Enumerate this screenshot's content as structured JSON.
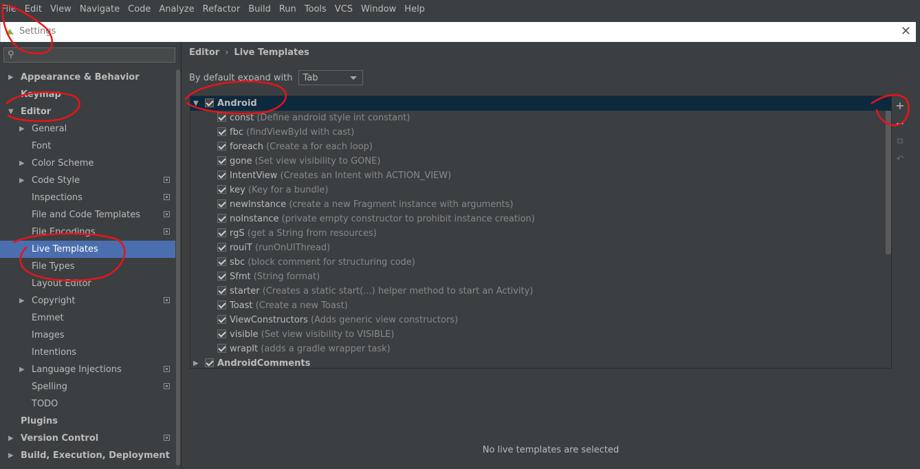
{
  "menu": [
    "File",
    "Edit",
    "View",
    "Navigate",
    "Code",
    "Analyze",
    "Refactor",
    "Build",
    "Run",
    "Tools",
    "VCS",
    "Window",
    "Help"
  ],
  "dialog": {
    "title": "Settings",
    "close_glyph": "✕"
  },
  "search": {
    "icon": "search-icon",
    "placeholder": ""
  },
  "tree": [
    {
      "label": "Appearance & Behavior",
      "level": 0,
      "arrow": "right",
      "bold": true,
      "proj": false
    },
    {
      "label": "Keymap",
      "level": 0,
      "arrow": "",
      "bold": true,
      "proj": false
    },
    {
      "label": "Editor",
      "level": 0,
      "arrow": "down",
      "bold": true,
      "proj": false
    },
    {
      "label": "General",
      "level": 1,
      "arrow": "right",
      "bold": false,
      "proj": false
    },
    {
      "label": "Font",
      "level": 1,
      "arrow": "",
      "bold": false,
      "proj": false
    },
    {
      "label": "Color Scheme",
      "level": 1,
      "arrow": "right",
      "bold": false,
      "proj": false
    },
    {
      "label": "Code Style",
      "level": 1,
      "arrow": "right",
      "bold": false,
      "proj": true
    },
    {
      "label": "Inspections",
      "level": 1,
      "arrow": "",
      "bold": false,
      "proj": true
    },
    {
      "label": "File and Code Templates",
      "level": 1,
      "arrow": "",
      "bold": false,
      "proj": true
    },
    {
      "label": "File Encodings",
      "level": 1,
      "arrow": "",
      "bold": false,
      "proj": true
    },
    {
      "label": "Live Templates",
      "level": 1,
      "arrow": "",
      "bold": false,
      "proj": false,
      "selected": true
    },
    {
      "label": "File Types",
      "level": 1,
      "arrow": "",
      "bold": false,
      "proj": false
    },
    {
      "label": "Layout Editor",
      "level": 1,
      "arrow": "",
      "bold": false,
      "proj": false
    },
    {
      "label": "Copyright",
      "level": 1,
      "arrow": "right",
      "bold": false,
      "proj": true
    },
    {
      "label": "Emmet",
      "level": 1,
      "arrow": "",
      "bold": false,
      "proj": false
    },
    {
      "label": "Images",
      "level": 1,
      "arrow": "",
      "bold": false,
      "proj": false
    },
    {
      "label": "Intentions",
      "level": 1,
      "arrow": "",
      "bold": false,
      "proj": false
    },
    {
      "label": "Language Injections",
      "level": 1,
      "arrow": "right",
      "bold": false,
      "proj": true
    },
    {
      "label": "Spelling",
      "level": 1,
      "arrow": "",
      "bold": false,
      "proj": true
    },
    {
      "label": "TODO",
      "level": 1,
      "arrow": "",
      "bold": false,
      "proj": false
    },
    {
      "label": "Plugins",
      "level": 0,
      "arrow": "",
      "bold": true,
      "proj": false
    },
    {
      "label": "Version Control",
      "level": 0,
      "arrow": "right",
      "bold": true,
      "proj": true
    },
    {
      "label": "Build, Execution, Deployment",
      "level": 0,
      "arrow": "right",
      "bold": true,
      "proj": false
    }
  ],
  "breadcrumb": {
    "first": "Editor",
    "sep": "›",
    "second": "Live Templates"
  },
  "expand": {
    "label": "By default expand with",
    "value": "Tab"
  },
  "groups": [
    {
      "name": "Android",
      "expanded": true,
      "checked": true,
      "selected": true,
      "templates": [
        {
          "abbr": "const",
          "desc": "(Define android style int constant)"
        },
        {
          "abbr": "fbc",
          "desc": "(findViewById with cast)"
        },
        {
          "abbr": "foreach",
          "desc": "(Create a for each loop)"
        },
        {
          "abbr": "gone",
          "desc": "(Set view visibility to GONE)"
        },
        {
          "abbr": "IntentView",
          "desc": "(Creates an Intent with ACTION_VIEW)"
        },
        {
          "abbr": "key",
          "desc": "(Key for a bundle)"
        },
        {
          "abbr": "newInstance",
          "desc": "(create a new Fragment instance with arguments)"
        },
        {
          "abbr": "noInstance",
          "desc": "(private empty constructor to prohibit instance creation)"
        },
        {
          "abbr": "rgS",
          "desc": "(get a String from resources)"
        },
        {
          "abbr": "rouiT",
          "desc": "(runOnUIThread)"
        },
        {
          "abbr": "sbc",
          "desc": "(block comment for structuring code)"
        },
        {
          "abbr": "Sfmt",
          "desc": "(String format)"
        },
        {
          "abbr": "starter",
          "desc": "(Creates a static start(...) helper method to start an Activity)"
        },
        {
          "abbr": "Toast",
          "desc": "(Create a new Toast)"
        },
        {
          "abbr": "ViewConstructors",
          "desc": "(Adds generic view constructors)"
        },
        {
          "abbr": "visible",
          "desc": "(Set view visibility to VISIBLE)"
        },
        {
          "abbr": "wrapIt",
          "desc": "(adds a gradle wrapper task)"
        }
      ]
    },
    {
      "name": "AndroidComments",
      "expanded": false,
      "checked": true,
      "selected": false,
      "templates": []
    }
  ],
  "actions": [
    {
      "name": "add-icon",
      "glyph": "+"
    },
    {
      "name": "remove-icon",
      "glyph": "−"
    },
    {
      "name": "copy-icon",
      "glyph": "⧉"
    },
    {
      "name": "restore-icon",
      "glyph": "↶"
    }
  ],
  "empty_message": "No live templates are selected",
  "colors": {
    "selection": "#4b6eaf",
    "group_selection": "#0d293e",
    "annotation": "#e8141b"
  }
}
